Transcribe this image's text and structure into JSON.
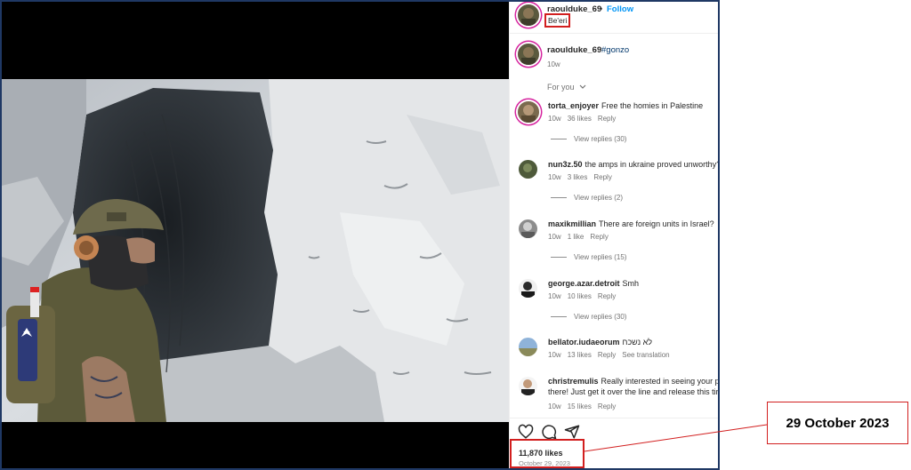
{
  "post": {
    "username": "raoulduke_69",
    "separator": "•",
    "follow_label": "Follow",
    "location": "Be'eri",
    "caption_tag": "#gonzo",
    "caption_time": "10w"
  },
  "comments_filter": "For you",
  "comments": [
    {
      "user": "torta_enjoyer",
      "text": "Free the homies in Palestine",
      "time": "10w",
      "likes": "36 likes",
      "reply": "Reply",
      "replies": "View replies (30)"
    },
    {
      "user": "nun3z.50",
      "text": "the amps in ukraine proved unworthy?",
      "time": "10w",
      "likes": "3 likes",
      "reply": "Reply",
      "replies": "View replies (2)"
    },
    {
      "user": "maxikmillian",
      "text": "There are foreign units in Israel?",
      "time": "10w",
      "likes": "1 like",
      "reply": "Reply",
      "replies": "View replies (15)"
    },
    {
      "user": "george.azar.detroit",
      "text": "Smh",
      "time": "10w",
      "likes": "10 likes",
      "reply": "Reply",
      "replies": "View replies (30)"
    },
    {
      "user": "bellator.iudaeorum",
      "text": "לא נשכח",
      "time": "10w",
      "likes": "13 likes",
      "reply": "Reply",
      "extra": "See translation"
    },
    {
      "user": "christremulis",
      "text": "Really interested in seeing your pe",
      "text2": "there! Just get it over the line and release this tir",
      "time": "10w",
      "likes": "15 likes",
      "reply": "Reply"
    }
  ],
  "footer": {
    "likes": "11,870 likes",
    "date": "October 29, 2023"
  },
  "annotation": {
    "label": "29 October 2023",
    "color": "#d21f1f"
  },
  "icons": [
    "heart-icon",
    "comment-icon",
    "share-icon",
    "chevron-down-icon"
  ]
}
